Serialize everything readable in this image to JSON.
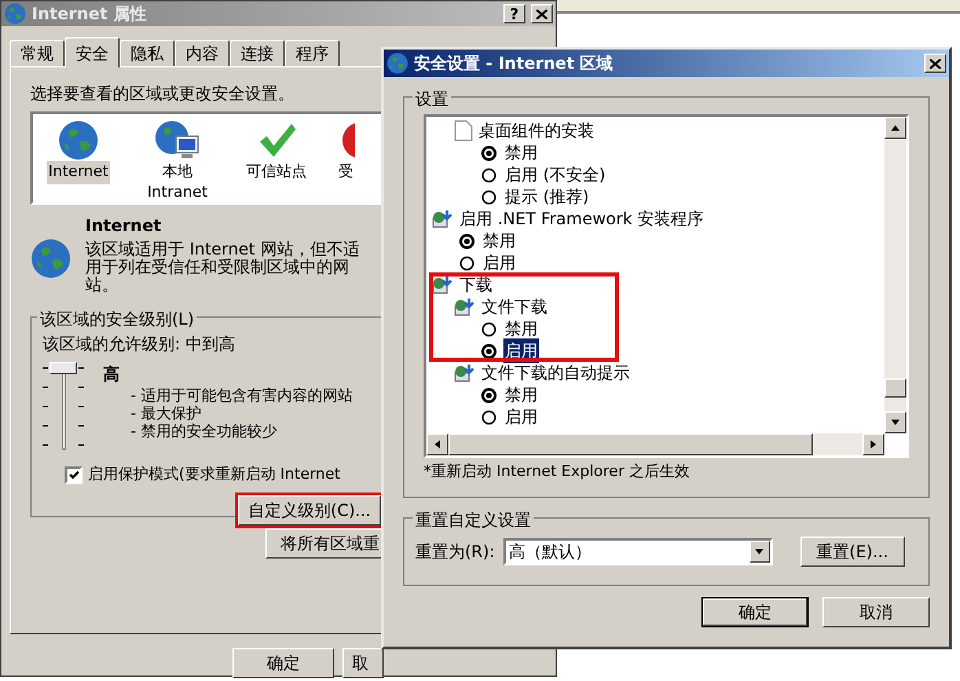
{
  "properties_window": {
    "title": "Internet 属性",
    "help_button": "?",
    "tabs": [
      {
        "label": "常规",
        "selected": false
      },
      {
        "label": "安全",
        "selected": true
      },
      {
        "label": "隐私",
        "selected": false
      },
      {
        "label": "内容",
        "selected": false
      },
      {
        "label": "连接",
        "selected": false
      },
      {
        "label": "程序",
        "selected": false
      }
    ],
    "prompt": "选择要查看的区域或更改安全设置。",
    "zones": [
      {
        "label": "Internet",
        "kind": "globe",
        "selected": true
      },
      {
        "label": "本地",
        "sublabel": "Intranet",
        "kind": "intranet",
        "selected": false
      },
      {
        "label": "可信站点",
        "kind": "trusted",
        "selected": false
      },
      {
        "label": "受",
        "kind": "restricted",
        "selected": false
      }
    ],
    "zone_title": "Internet",
    "zone_description": "该区域适用于 Internet 网站，但不适用于列在受信任和受限制区域中的网站。",
    "security_group": {
      "title": "该区域的安全级别(L)",
      "allowed": "该区域的允许级别: 中到高",
      "level": 1,
      "level_name": "高",
      "bullets": [
        "- 适用于可能包含有害内容的网站",
        "- 最大保护",
        "- 禁用的安全功能较少"
      ],
      "protected_mode": {
        "label": "启用保护模式(要求重新启动 Internet",
        "checked": true
      },
      "custom_button": {
        "label": "自定义级别(C)...",
        "highlighted": true
      }
    },
    "reset_all_button": "将所有区域重",
    "buttons": [
      "确定",
      "取"
    ]
  },
  "settings_window": {
    "title": "安全设置 - Internet 区域",
    "settings_group": "设置",
    "tree": [
      {
        "children": [
          {
            "kind": "page",
            "label": "桌面组件的安装",
            "options": [
              {
                "label": "禁用",
                "selected": true
              },
              {
                "label": "启用 (不安全)",
                "selected": false
              },
              {
                "label": "提示 (推荐)",
                "selected": false
              }
            ]
          }
        ]
      },
      {
        "kind": "component",
        "label": "启用 .NET Framework 安装程序",
        "options": [
          {
            "label": "禁用",
            "selected": true
          },
          {
            "label": "启用",
            "selected": false
          }
        ]
      },
      {
        "kind": "component",
        "label": "下载",
        "highlighted": true,
        "children": [
          {
            "kind": "component",
            "label": "文件下载",
            "options": [
              {
                "label": "禁用",
                "selected": false
              },
              {
                "label": "启用",
                "selected": true,
                "focused": true
              }
            ]
          },
          {
            "kind": "component",
            "label": "文件下载的自动提示",
            "options": [
              {
                "label": "禁用",
                "selected": true
              },
              {
                "label": "启用",
                "selected": false
              }
            ]
          }
        ]
      }
    ],
    "note": "*重新启动 Internet Explorer 之后生效",
    "reset_group": {
      "title": "重置自定义设置",
      "label": "重置为(R):",
      "value": "高（默认）",
      "button": "重置(E)..."
    },
    "buttons": [
      {
        "label": "确定",
        "default": true
      },
      {
        "label": "取消",
        "default": false
      }
    ]
  }
}
